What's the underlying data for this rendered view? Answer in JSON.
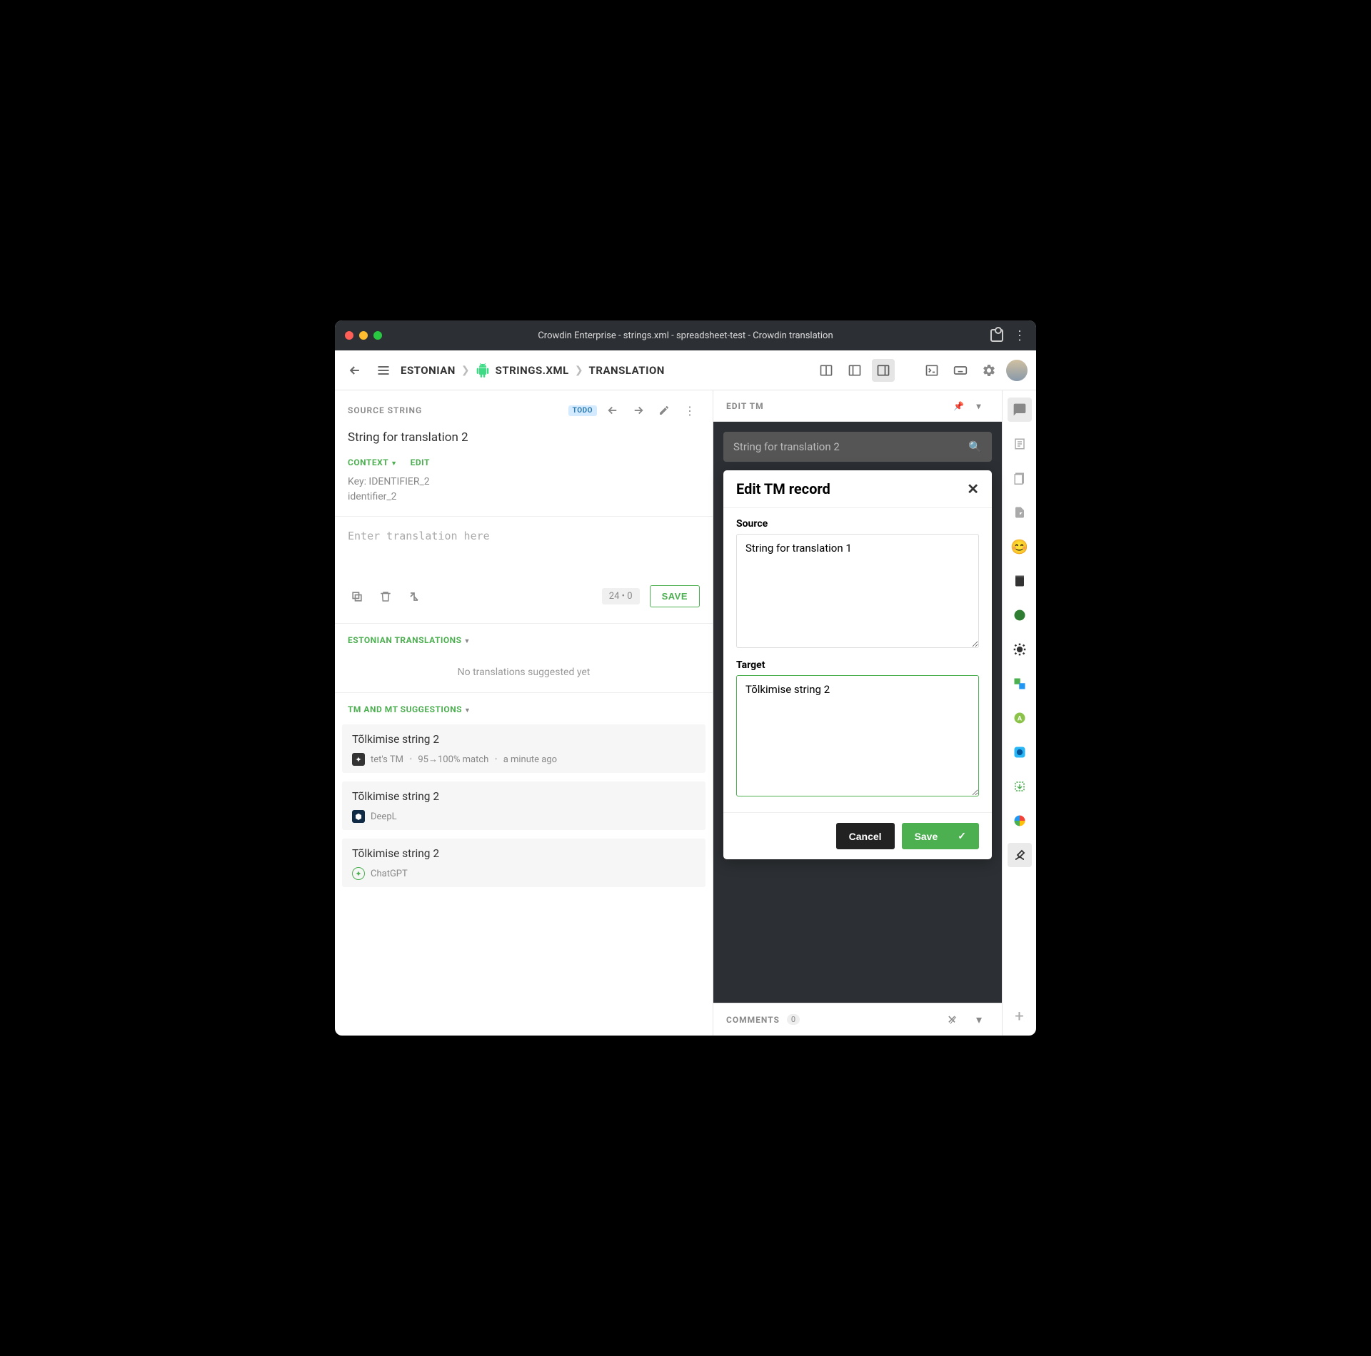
{
  "window": {
    "title": "Crowdin Enterprise - strings.xml - spreadsheet-test - Crowdin translation"
  },
  "breadcrumb": {
    "lang": "ESTONIAN",
    "file": "STRINGS.XML",
    "section": "TRANSLATION"
  },
  "source": {
    "header": "SOURCE STRING",
    "todo": "TODO",
    "text": "String for translation 2",
    "context_label": "CONTEXT",
    "edit_label": "EDIT",
    "key_line1": "Key: IDENTIFIER_2",
    "key_line2": "identifier_2"
  },
  "translation": {
    "placeholder": "Enter translation here",
    "count": "24  •  0",
    "save": "SAVE"
  },
  "sections": {
    "translations_header": "ESTONIAN TRANSLATIONS",
    "no_translations": "No translations suggested yet",
    "suggestions_header": "TM AND MT SUGGESTIONS"
  },
  "suggestions": [
    {
      "text": "Tõlkimise string 2",
      "engine": "tet's TM",
      "match": "95→100% match",
      "time": "a minute ago",
      "icon": "tm"
    },
    {
      "text": "Tõlkimise string 2",
      "engine": "DeepL",
      "icon": "deepl"
    },
    {
      "text": "Tõlkimise string 2",
      "engine": "ChatGPT",
      "icon": "gpt"
    }
  ],
  "right": {
    "header": "EDIT TM",
    "search": "String for translation 2",
    "modal": {
      "title": "Edit TM record",
      "source_label": "Source",
      "source_value": "String for translation 1",
      "target_label": "Target",
      "target_value": "Tõlkimise string 2",
      "cancel": "Cancel",
      "save": "Save"
    }
  },
  "comments": {
    "label": "COMMENTS",
    "count": "0"
  }
}
